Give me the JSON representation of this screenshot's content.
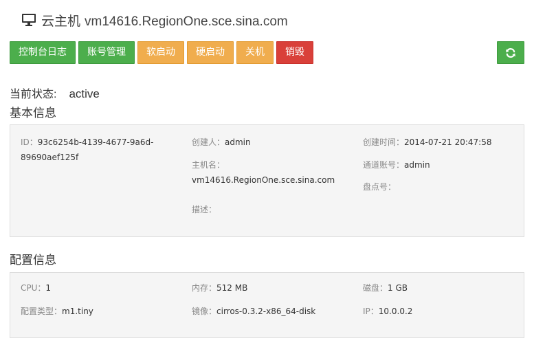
{
  "header": {
    "title_prefix": "云主机",
    "hostname": "vm14616.RegionOne.sce.sina.com"
  },
  "toolbar": {
    "buttons": [
      {
        "label": "控制台日志",
        "color": "#4cae4c"
      },
      {
        "label": "账号管理",
        "color": "#4cae4c"
      },
      {
        "label": "软启动",
        "color": "#f0ad4e"
      },
      {
        "label": "硬启动",
        "color": "#f0ad4e"
      },
      {
        "label": "关机",
        "color": "#f0ad4e"
      },
      {
        "label": "销毁",
        "color": "#d9403a"
      }
    ],
    "refresh_icon": "refresh-icon"
  },
  "status": {
    "label": "当前状态:",
    "value": "active"
  },
  "basic_info": {
    "title": "基本信息",
    "id_label": "ID：",
    "id_value_line1": "93c6254b-4139-4677-9a6d-",
    "id_value_line2": "89690aef125f",
    "creator_label": "创建人：",
    "creator_value": "admin",
    "hostname_label": "主机名：",
    "hostname_value": "vm14616.RegionOne.sce.sina.com",
    "desc_label": "描述：",
    "desc_value": "",
    "created_label": "创建时间：",
    "created_value": "2014-07-21 20:47:58",
    "channel_label": "通道账号：",
    "channel_value": "admin",
    "inventory_label": "盘点号：",
    "inventory_value": ""
  },
  "config_info": {
    "title": "配置信息",
    "cpu_label": "CPU：",
    "cpu_value": "1",
    "memory_label": "内存：",
    "memory_value": "512 MB",
    "disk_label": "磁盘：",
    "disk_value": "1 GB",
    "type_label": "配置类型：",
    "type_value": "m1.tiny",
    "image_label": "镜像：",
    "image_value": "cirros-0.3.2-x86_64-disk",
    "ip_label": "IP：",
    "ip_value": "10.0.0.2"
  }
}
